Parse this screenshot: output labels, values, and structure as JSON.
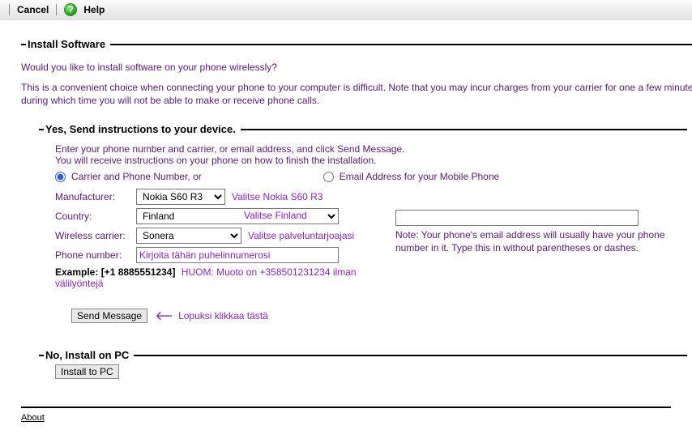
{
  "topbar": {
    "cancel": "Cancel",
    "help": "Help"
  },
  "main": {
    "title": "Install Software",
    "question": "Would you like to install software on your phone wirelessly?",
    "description": "This is a convenient choice when connecting your phone to your computer is difficult. Note that you may incur charges from your carrier for one a few minutes, during which time you will not be able to make or receive phone calls."
  },
  "send": {
    "legend": "Yes, Send instructions to your device.",
    "inst1": "Enter your phone number and carrier, or email address, and click Send Message.",
    "inst2": "You will receive instructions on your phone on how to finish the installation.",
    "carrierOptLabel": "Carrier and Phone Number, or",
    "emailOptLabel": "Email Address for your Mobile Phone",
    "labels": {
      "manufacturer": "Manufacturer:",
      "country": "Country:",
      "carrier": "Wireless carrier:",
      "phone": "Phone number:"
    },
    "values": {
      "manufacturer": "Nokia S60 R3",
      "country": "Finland",
      "carrier": "Sonera",
      "phonePlaceholder": "Kirjoita tähän puhelinnumerosi"
    },
    "notes": {
      "manufacturer": "Valitse Nokia S60 R3",
      "country": "Valitse Finland",
      "carrier": "Valitse palveluntarjoajasi"
    },
    "exampleLabel": "Example: [+1 8885551234]",
    "exampleNote": "HUOM: Muoto on +358501231234 ilman välilyöntejä",
    "emailNote": "Note: Your phone's email address will usually have your phone number in it. Type this in without parentheses or dashes.",
    "sendBtn": "Send Message",
    "sendNote": "Lopuksi klikkaa tästä"
  },
  "nopc": {
    "legend": "No, Install on PC",
    "btn": "Install to PC"
  },
  "footer": {
    "about": "About"
  }
}
